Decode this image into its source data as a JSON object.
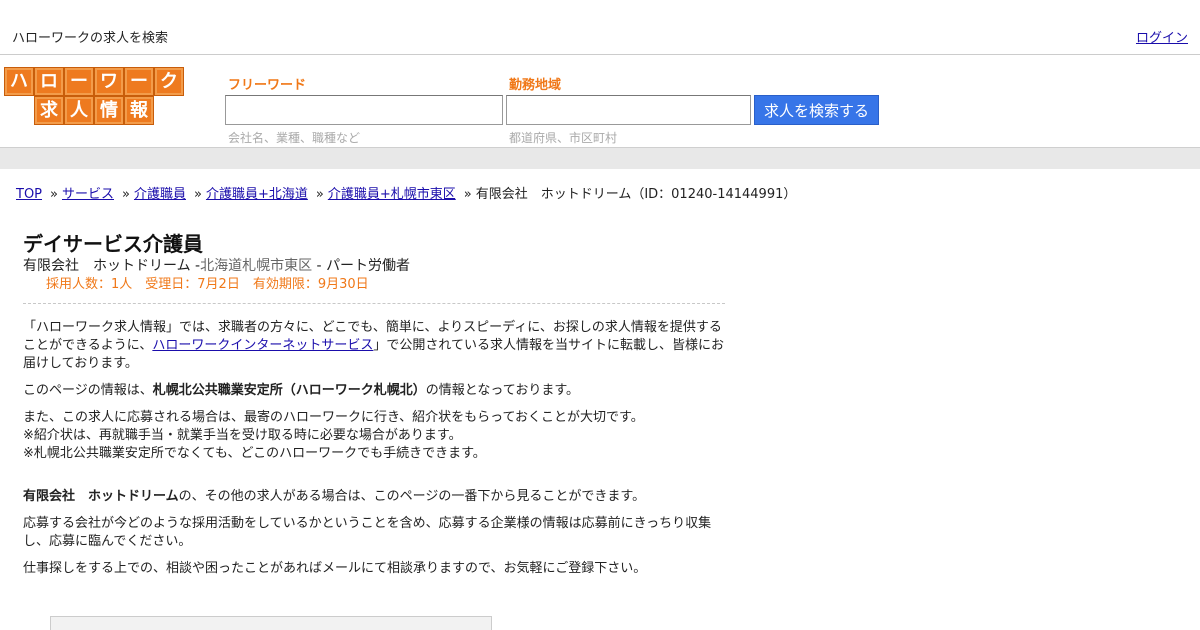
{
  "topbar": {
    "tagline": "ハローワークの求人を検索",
    "login": "ログイン"
  },
  "logo": {
    "row1": [
      "ハ",
      "ロ",
      "ー",
      "ワ",
      "ー",
      "ク"
    ],
    "row2": [
      "求",
      "人",
      "情",
      "報"
    ],
    "color": "#ee7a1f"
  },
  "search": {
    "keyword_label": "フリーワード",
    "keyword_value": "",
    "keyword_hint": "会社名、業種、職種など",
    "area_label": "勤務地域",
    "area_value": "",
    "area_hint": "都道府県、市区町村",
    "button": "求人を検索する",
    "accent": "#f07818",
    "button_color": "#3775e8"
  },
  "breadcrumb": {
    "items": [
      "TOP",
      "サービス",
      "介護職員",
      "介護職員+北海道",
      "介護職員+札幌市東区"
    ],
    "separator": "»",
    "current": "有限会社　ホットドリーム（ID：01240-14144991）"
  },
  "job": {
    "title": "デイサービス介護員",
    "company": "有限会社　ホットドリーム",
    "location": "北海道札幌市東区",
    "employment": "パート労働者",
    "meta": "採用人数：1人　受理日：7月2日　有効期限：9月30日"
  },
  "body": {
    "p1_pre": "「ハローワーク求人情報」では、求職者の方々に、どこでも、簡単に、よりスピーディに、お探しの求人情報を提供することができるように、",
    "p1_link": "ハローワークインターネットサービス",
    "p1_post": "」で公開されている求人情報を当サイトに転載し、皆様にお届けしております。",
    "p2_pre": "このページの情報は、",
    "p2_bold": "札幌北公共職業安定所（ハローワーク札幌北）",
    "p2_post": "の情報となっております。",
    "p3_line1": "また、この求人に応募される場合は、最寄のハローワークに行き、紹介状をもらっておくことが大切です。",
    "p3_line2": "※紹介状は、再就職手当・就業手当を受け取る時に必要な場合があります。",
    "p3_line3": "※札幌北公共職業安定所でなくても、どこのハローワークでも手続きできます。",
    "p4_bold": "有限会社　ホットドリーム",
    "p4_post": "の、その他の求人がある場合は、このページの一番下から見ることができます。",
    "p5": "応募する会社が今どのような採用活動をしているかということを含め、応募する企業様の情報は応募前にきっちり収集し、応募に臨んでください。",
    "p6": "仕事探しをする上での、相談や困ったことがあればメールにて相談承りますので、お気軽にご登録下さい。"
  }
}
